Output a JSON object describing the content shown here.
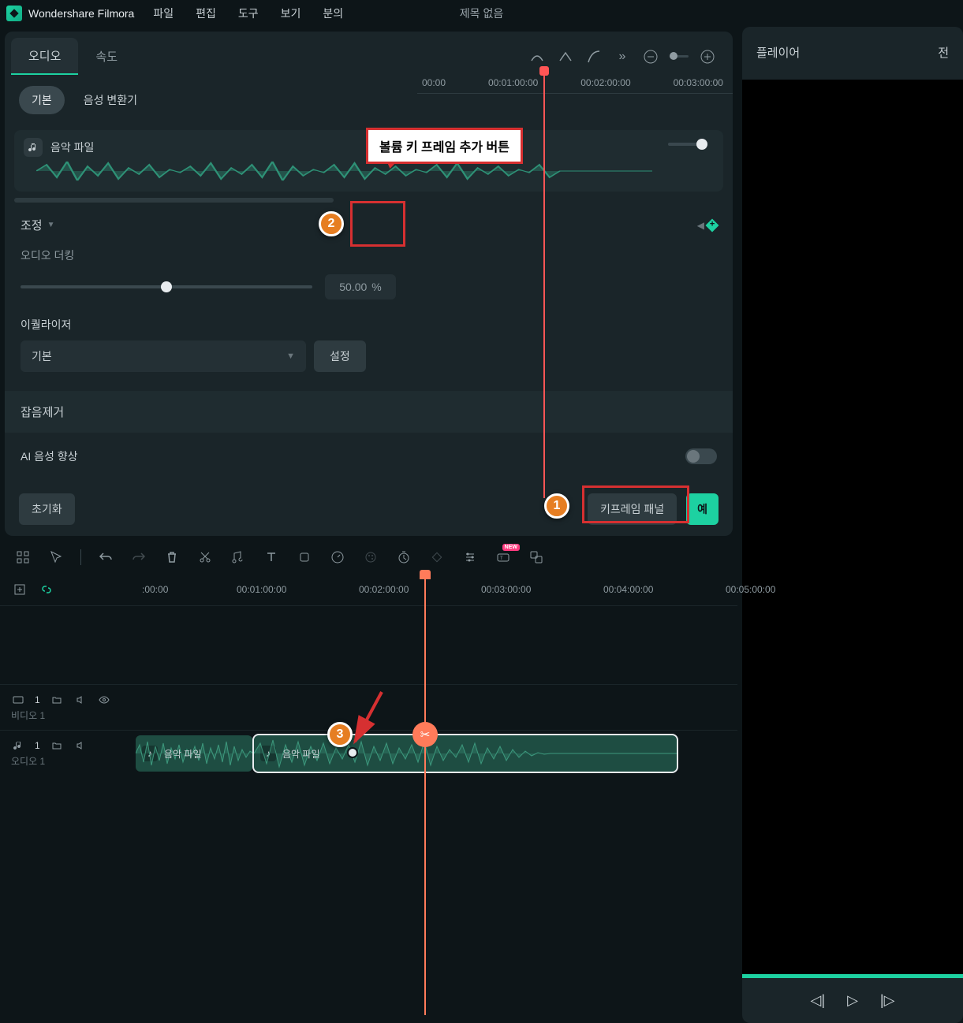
{
  "app": {
    "name": "Wondershare Filmora",
    "title": "제목 없음"
  },
  "menu": {
    "file": "파일",
    "edit": "편집",
    "tools": "도구",
    "view": "보기",
    "analysis": "분의"
  },
  "panel": {
    "tabs": {
      "audio": "오디오",
      "speed": "속도"
    },
    "subtabs": {
      "basic": "기본",
      "voice_changer": "음성 변환기"
    },
    "clip_name": "음악 파일",
    "adjust": "조정",
    "ducking_label": "오디오 더킹",
    "ducking_value": "50.00",
    "ducking_unit": "%",
    "eq_label": "이퀄라이저",
    "eq_preset": "기본",
    "eq_settings_btn": "설정",
    "denoise": "잡음제거",
    "ai_enhance": "AI 음성 향상",
    "reset_btn": "초기화",
    "keyframe_panel_btn": "키프레임 패널",
    "yes_btn": "예",
    "ruler": [
      "00:00",
      "00:01:00:00",
      "00:02:00:00",
      "00:03:00:00"
    ]
  },
  "player": {
    "tab": "플레이어",
    "tab2": "전"
  },
  "timeline": {
    "ruler": [
      ":00:00",
      "00:01:00:00",
      "00:02:00:00",
      "00:03:00:00",
      "00:04:00:00",
      "00:05:00:00"
    ],
    "video_track": {
      "index": "1",
      "name": "비디오 1"
    },
    "audio_track": {
      "index": "1",
      "name": "오디오 1"
    },
    "clip1_name": "음악 파일",
    "clip2_name": "음악 파일"
  },
  "annotations": {
    "callout_text": "볼륨 키 프레임 추가 버튼",
    "badge1": "1",
    "badge2": "2",
    "badge3": "3",
    "new_badge": "NEW"
  }
}
